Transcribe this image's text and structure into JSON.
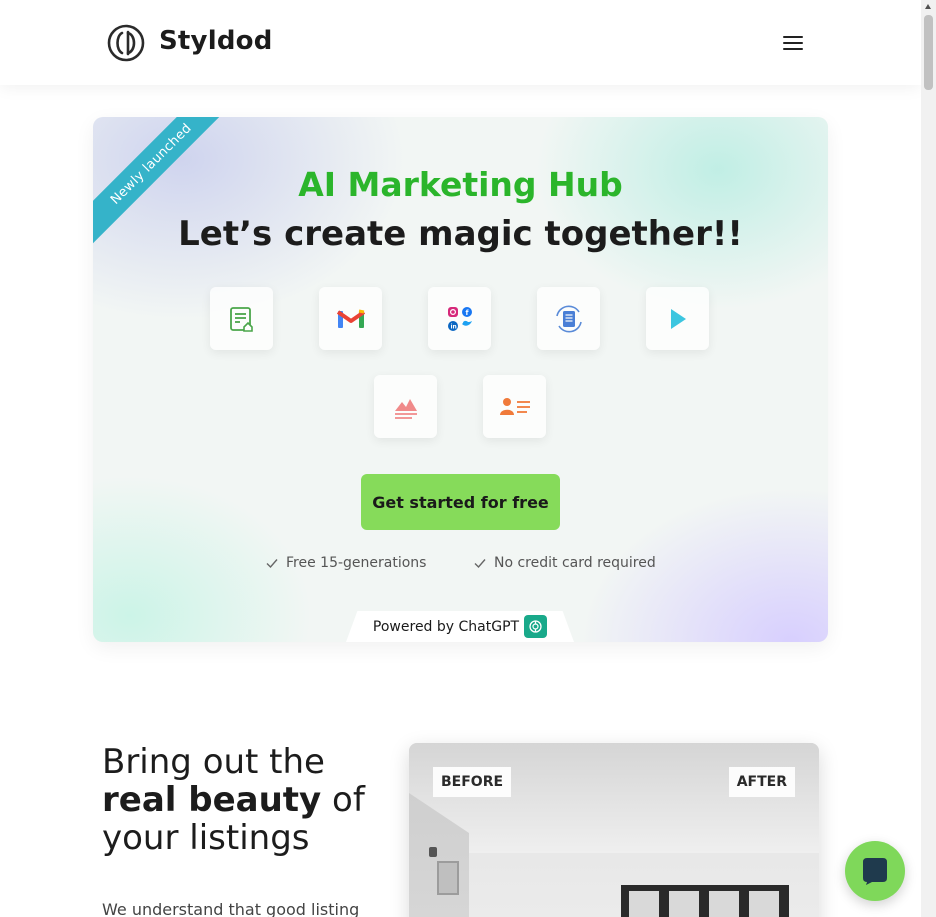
{
  "header": {
    "logo_text": "Styldod",
    "menu_icon": "hamburger-menu-icon"
  },
  "hero": {
    "ribbon": "Newly launched",
    "title": "AI Marketing Hub",
    "subtitle": "Let’s create magic together!!",
    "tools": [
      {
        "icon": "listing-description-icon"
      },
      {
        "icon": "gmail-icon"
      },
      {
        "icon": "social-media-icon"
      },
      {
        "icon": "document-sync-icon"
      },
      {
        "icon": "play-video-icon"
      },
      {
        "icon": "property-image-icon"
      },
      {
        "icon": "agent-profile-icon"
      }
    ],
    "cta_label": "Get started for free",
    "features": [
      "Free 15-generations",
      "No credit card required"
    ],
    "powered_by": "Powered by ChatGPT",
    "colors": {
      "title": "#2bb52b",
      "cta": "#86db5a",
      "ribbon": "#35b3c9"
    }
  },
  "section": {
    "title_line1": "Bring out the",
    "title_bold": "real beauty",
    "title_after_bold": " of",
    "title_line3": "your listings",
    "body": "We understand that good listing",
    "before_label": "BEFORE",
    "after_label": "AFTER"
  },
  "chat": {
    "icon": "chat-bubble-icon"
  }
}
